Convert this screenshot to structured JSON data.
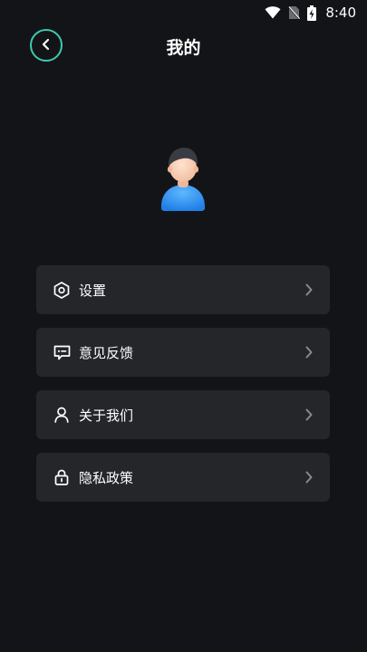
{
  "status_bar": {
    "time": "8:40",
    "icons": [
      "wifi-icon",
      "no-sim-icon",
      "battery-charging-icon"
    ]
  },
  "header": {
    "back_icon": "chevron-left-icon",
    "title": "我的"
  },
  "avatar": {
    "icon": "user-avatar"
  },
  "menu": {
    "items": [
      {
        "label": "设置",
        "icon": "hexagon-settings-icon"
      },
      {
        "label": "意见反馈",
        "icon": "feedback-icon"
      },
      {
        "label": "关于我们",
        "icon": "person-icon"
      },
      {
        "label": "隐私政策",
        "icon": "lock-icon"
      }
    ]
  },
  "colors": {
    "background": "#131418",
    "card": "#25262a",
    "accent": "#3ec9b0",
    "text": "#ffffff",
    "chevron": "#8a8b90"
  }
}
